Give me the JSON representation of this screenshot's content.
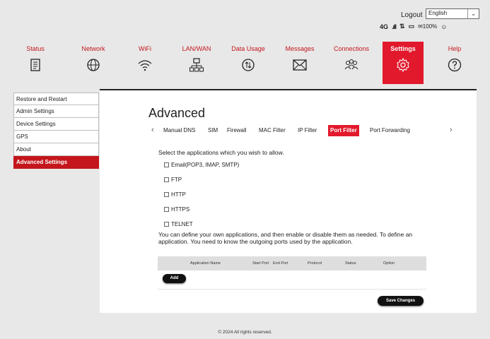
{
  "header": {
    "logout_label": "Logout",
    "language": "English",
    "network_type": "4G",
    "battery": "100%"
  },
  "nav": [
    {
      "label": "Status",
      "icon": "status-icon"
    },
    {
      "label": "Network",
      "icon": "globe-icon"
    },
    {
      "label": "WiFi",
      "icon": "wifi-icon"
    },
    {
      "label": "LAN/WAN",
      "icon": "lan-icon"
    },
    {
      "label": "Data Usage",
      "icon": "data-usage-icon"
    },
    {
      "label": "Messages",
      "icon": "envelope-icon"
    },
    {
      "label": "Connections",
      "icon": "users-icon"
    },
    {
      "label": "Settings",
      "icon": "gear-icon",
      "active": true
    },
    {
      "label": "Help",
      "icon": "help-icon"
    }
  ],
  "sidebar": {
    "items": [
      {
        "label": "Restore and Restart"
      },
      {
        "label": "Admin Settings"
      },
      {
        "label": "Device Settings"
      },
      {
        "label": "GPS"
      },
      {
        "label": "About"
      },
      {
        "label": "Advanced Settings",
        "active": true
      }
    ]
  },
  "main": {
    "title": "Advanced",
    "tabs": [
      {
        "label": "Manual DNS"
      },
      {
        "label": "SIM"
      },
      {
        "label": "Firewall"
      },
      {
        "label": "MAC Filter"
      },
      {
        "label": "IP Filter"
      },
      {
        "label": "Port Filter",
        "active": true
      },
      {
        "label": "Port Forwarding"
      }
    ],
    "intro": "Select the applications which you wish to allow.",
    "apps": [
      {
        "label": "Email(POP3, IMAP, SMTP)",
        "checked": false
      },
      {
        "label": "FTP",
        "checked": false
      },
      {
        "label": "HTTP",
        "checked": false
      },
      {
        "label": "HTTPS",
        "checked": false
      },
      {
        "label": "TELNET",
        "checked": false
      }
    ],
    "description": "You can define your own applications, and then enable or disable them as needed. To define an application. You need to know the outgoing ports used by the application.",
    "table": {
      "columns": [
        "Application Name",
        "Start Port",
        "End Port",
        "Protocol",
        "Status",
        "Option"
      ]
    },
    "add_label": "Add",
    "save_label": "Save Changes"
  },
  "footer": "© 2024 All rights reserved.",
  "colors": {
    "accent": "#e2192c",
    "accent_text": "#c4161c",
    "background": "#e8e8e8"
  }
}
